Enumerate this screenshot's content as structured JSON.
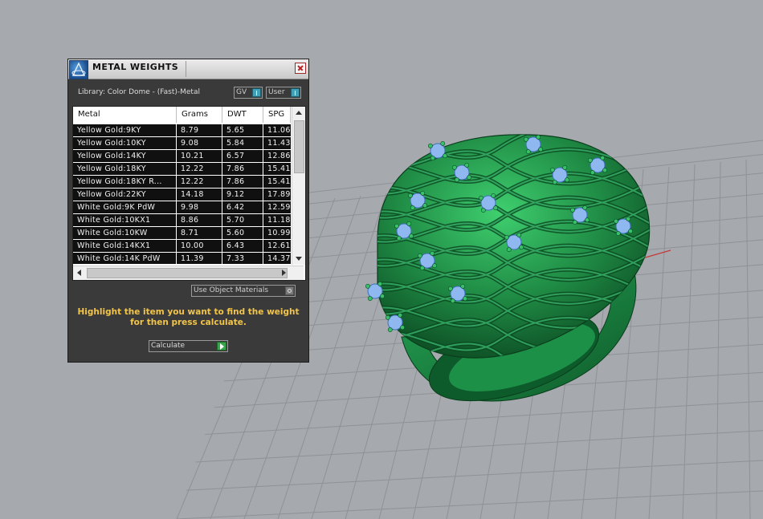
{
  "panel": {
    "title": "METAL WEIGHTS",
    "library_label": "Library: Color Dome - (Fast)-Metal",
    "toggle_gv": "GV",
    "toggle_user": "User",
    "use_object_materials": "Use Object Materials",
    "hint": "Highlight the item you want to find the weight for then press calculate.",
    "calculate_label": "Calculate"
  },
  "table": {
    "headers": [
      "Metal",
      "Grams",
      "DWT",
      "SPG"
    ],
    "rows": [
      [
        "Yellow Gold:9KY",
        "8.79",
        "5.65",
        "11.06"
      ],
      [
        "Yellow Gold:10KY",
        "9.08",
        "5.84",
        "11.43"
      ],
      [
        "Yellow Gold:14KY",
        "10.21",
        "6.57",
        "12.86"
      ],
      [
        "Yellow Gold:18KY",
        "12.22",
        "7.86",
        "15.41"
      ],
      [
        "Yellow Gold:18KY R...",
        "12.22",
        "7.86",
        "15.41"
      ],
      [
        "Yellow Gold:22KY",
        "14.18",
        "9.12",
        "17.89"
      ],
      [
        "White Gold:9K PdW",
        "9.98",
        "6.42",
        "12.59"
      ],
      [
        "White Gold:10KX1",
        "8.86",
        "5.70",
        "11.18"
      ],
      [
        "White Gold:10KW",
        "8.71",
        "5.60",
        "10.99"
      ],
      [
        "White Gold:14KX1",
        "10.00",
        "6.43",
        "12.61"
      ],
      [
        "White Gold:14K PdW",
        "11.39",
        "7.33",
        "14.37"
      ]
    ]
  },
  "viewport": {
    "background": "#a6aaae",
    "grid_color": "#8e9297",
    "ring_color": "#1f8a44",
    "gem_color": "#8fb8f0"
  }
}
